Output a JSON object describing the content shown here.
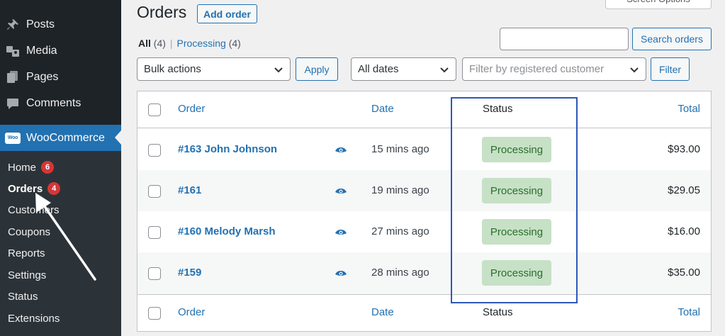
{
  "sidebar": {
    "menu": [
      {
        "label": "Posts",
        "icon": "pin-icon"
      },
      {
        "label": "Media",
        "icon": "media-icon"
      },
      {
        "label": "Pages",
        "icon": "pages-icon"
      },
      {
        "label": "Comments",
        "icon": "comments-icon"
      }
    ],
    "woocommerce": {
      "label": "WooCommerce",
      "logo_text": "Woo"
    },
    "submenu": [
      {
        "label": "Home",
        "count": "6"
      },
      {
        "label": "Orders",
        "count": "4"
      },
      {
        "label": "Customers"
      },
      {
        "label": "Coupons"
      },
      {
        "label": "Reports"
      },
      {
        "label": "Settings"
      },
      {
        "label": "Status"
      },
      {
        "label": "Extensions"
      }
    ]
  },
  "header": {
    "title": "Orders",
    "add_order_label": "Add order",
    "screen_options_label": "Screen Options"
  },
  "filters_nav": {
    "all_label": "All",
    "all_count": "(4)",
    "separator": "|",
    "processing_label": "Processing",
    "processing_count": "(4)"
  },
  "search": {
    "value": "",
    "button_label": "Search orders"
  },
  "toolbar": {
    "bulk_actions": "Bulk actions",
    "apply_label": "Apply",
    "dates": "All dates",
    "customer_placeholder": "Filter by registered customer",
    "filter_label": "Filter"
  },
  "table": {
    "columns": {
      "order": "Order",
      "date": "Date",
      "status": "Status",
      "total": "Total"
    },
    "rows": [
      {
        "order": "#163 John Johnson",
        "date": "15 mins ago",
        "status": "Processing",
        "total": "$93.00"
      },
      {
        "order": "#161",
        "date": "19 mins ago",
        "status": "Processing",
        "total": "$29.05"
      },
      {
        "order": "#160 Melody Marsh",
        "date": "27 mins ago",
        "status": "Processing",
        "total": "$16.00"
      },
      {
        "order": "#159",
        "date": "28 mins ago",
        "status": "Processing",
        "total": "$35.00"
      }
    ]
  },
  "colors": {
    "sidebar_bg": "#1d2327",
    "accent": "#2271b1",
    "badge_red": "#d63638",
    "processing_bg": "#c6e1c6",
    "processing_text": "#2c6e2c",
    "highlight_box": "#2e57b8"
  }
}
